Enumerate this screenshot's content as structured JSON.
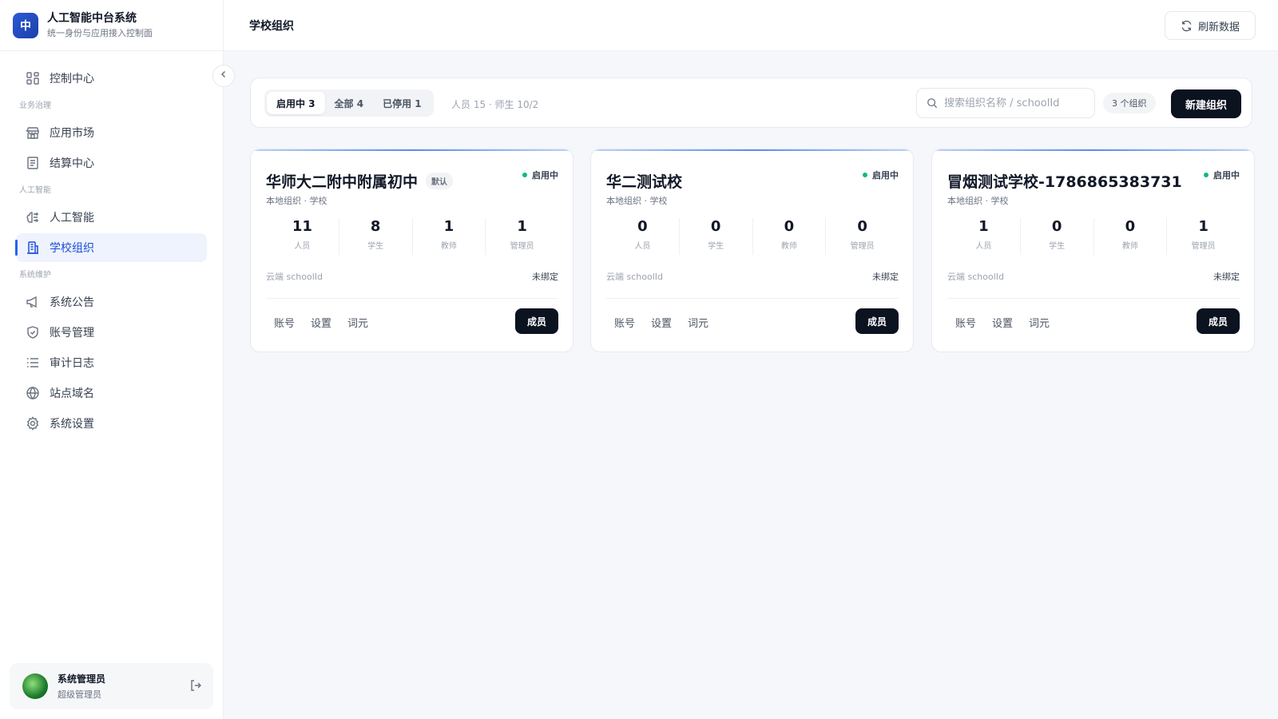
{
  "app": {
    "logo_char": "中",
    "title": "人工智能中台系统",
    "subtitle": "统一身份与应用接入控制面"
  },
  "sidebar": {
    "items": [
      {
        "label": "控制中心",
        "icon": "dashboard-icon"
      },
      {
        "section": "业务治理"
      },
      {
        "label": "应用市场",
        "icon": "store-icon"
      },
      {
        "label": "结算中心",
        "icon": "document-icon"
      },
      {
        "section": "人工智能"
      },
      {
        "label": "人工智能",
        "icon": "brain-icon"
      },
      {
        "label": "学校组织",
        "icon": "building-icon",
        "active": true
      },
      {
        "section": "系统维护"
      },
      {
        "label": "系统公告",
        "icon": "megaphone-icon"
      },
      {
        "label": "账号管理",
        "icon": "shield-icon"
      },
      {
        "label": "审计日志",
        "icon": "list-icon"
      },
      {
        "label": "站点域名",
        "icon": "globe-icon"
      },
      {
        "label": "系统设置",
        "icon": "gear-icon"
      }
    ],
    "user": {
      "name": "系统管理员",
      "role": "超级管理员"
    }
  },
  "header": {
    "title": "学校组织",
    "refresh_label": "刷新数据"
  },
  "toolbar": {
    "tabs": [
      {
        "label": "启用中 3",
        "active": true
      },
      {
        "label": "全部 4",
        "active": false
      },
      {
        "label": "已停用 1",
        "active": false
      }
    ],
    "summary": "人员 15 · 师生 10/2",
    "search_placeholder": "搜索组织名称 / schoolId",
    "count": "3 个组织",
    "new_label": "新建组织"
  },
  "cards": [
    {
      "name": "华师大二附中附属初中",
      "default_tag": "默认",
      "status": "启用中",
      "sub": "本地组织 · 学校",
      "stats": [
        {
          "value": "11",
          "label": "人员"
        },
        {
          "value": "8",
          "label": "学生"
        },
        {
          "value": "1",
          "label": "教师"
        },
        {
          "value": "1",
          "label": "管理员"
        }
      ],
      "bind_label": "云端 schoolId",
      "bind_value": "未绑定",
      "actions": [
        "账号",
        "设置",
        "词元"
      ],
      "member_label": "成员"
    },
    {
      "name": "华二测试校",
      "default_tag": "",
      "status": "启用中",
      "sub": "本地组织 · 学校",
      "stats": [
        {
          "value": "0",
          "label": "人员"
        },
        {
          "value": "0",
          "label": "学生"
        },
        {
          "value": "0",
          "label": "教师"
        },
        {
          "value": "0",
          "label": "管理员"
        }
      ],
      "bind_label": "云端 schoolId",
      "bind_value": "未绑定",
      "actions": [
        "账号",
        "设置",
        "词元"
      ],
      "member_label": "成员"
    },
    {
      "name": "冒烟测试学校-1786865383731",
      "default_tag": "",
      "status": "启用中",
      "sub": "本地组织 · 学校",
      "stats": [
        {
          "value": "1",
          "label": "人员"
        },
        {
          "value": "0",
          "label": "学生"
        },
        {
          "value": "0",
          "label": "教师"
        },
        {
          "value": "1",
          "label": "管理员"
        }
      ],
      "bind_label": "云端 schoolId",
      "bind_value": "未绑定",
      "actions": [
        "账号",
        "设置",
        "词元"
      ],
      "member_label": "成员"
    }
  ],
  "colors": {
    "accent": "#2563eb",
    "primary_button": "#0b1220",
    "status_active": "#10b981"
  }
}
